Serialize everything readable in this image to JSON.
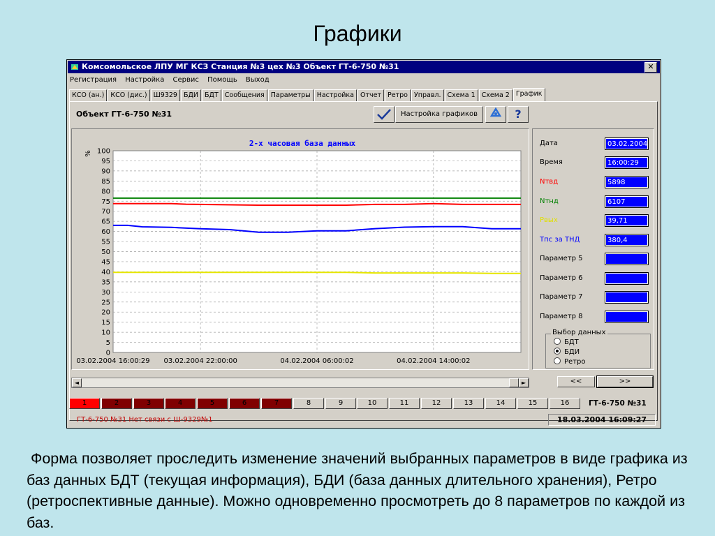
{
  "slide": {
    "title": "Графики",
    "caption": " Форма позволяет проследить изменение значений выбранных параметров в виде графика из баз данных БДТ (текущая информация), БДИ (база данных длительного хранения), Ретро (ретроспективные данные).  Можно одновременно просмотреть до 8 параметров по каждой из баз."
  },
  "window": {
    "title": "Комсомольское ЛПУ МГ КСЗ Станция №3  цех №3  Объект ГТ-6-750 №31",
    "close_label": "✕",
    "icon": "app-icon"
  },
  "menu": [
    "Регистрация",
    "Настройка",
    "Сервис",
    "Помощь",
    "Выход"
  ],
  "tabs": [
    "КСО (ан.)",
    "КСО (дис.)",
    "Ш9329",
    "БДИ",
    "БДТ",
    "Сообщения",
    "Параметры",
    "Настройка",
    "Отчет",
    "Ретро",
    "Управл.",
    "Схема 1",
    "Схема 2",
    "График"
  ],
  "active_tab": "График",
  "toolbar": {
    "object_label": "Объект ГТ-6-750 №31",
    "settings_button": "Настройка графиков",
    "icons": [
      "checkmark-icon",
      "recycle-icon",
      "help-icon"
    ]
  },
  "params": [
    {
      "label": "Дата",
      "value": "03.02.2004",
      "color": "#000000"
    },
    {
      "label": "Время",
      "value": "16:00:29",
      "color": "#000000"
    },
    {
      "label": "Nтвд",
      "value": "5898",
      "color": "#ff0000"
    },
    {
      "label": "Nтнд",
      "value": "6107",
      "color": "#008000"
    },
    {
      "label": "Рвых",
      "value": "39,71",
      "color": "#e0e000"
    },
    {
      "label": "Тпс за ТНД",
      "value": "380,4",
      "color": "#0000ff"
    },
    {
      "label": "Параметр 5",
      "value": "",
      "color": "#000000"
    },
    {
      "label": "Параметр 6",
      "value": "",
      "color": "#000000"
    },
    {
      "label": "Параметр 7",
      "value": "",
      "color": "#000000"
    },
    {
      "label": "Параметр 8",
      "value": "",
      "color": "#000000"
    }
  ],
  "data_select": {
    "title": "Выбор данных",
    "options": [
      "БДТ",
      "БДИ",
      "Ретро"
    ],
    "selected": "БДИ"
  },
  "nav": {
    "prev": "<<",
    "next": ">>"
  },
  "scroll": {
    "left": "◄",
    "right": "►"
  },
  "numbers": {
    "items": [
      "1",
      "2",
      "3",
      "4",
      "5",
      "6",
      "7",
      "8",
      "9",
      "10",
      "11",
      "12",
      "13",
      "14",
      "15",
      "16"
    ],
    "active": "1",
    "red_count": 7,
    "object_name": "ГТ-6-750 №31"
  },
  "status": {
    "message": "ГТ-6-750 №31 Нет связи с Ш-9329№1",
    "datetime": "18.03.2004 16:09:27"
  },
  "chart_data": {
    "type": "line",
    "title": "2-х часовая база данных",
    "ylabel": "%",
    "ylim": [
      0,
      100
    ],
    "yticks": [
      0,
      5,
      10,
      15,
      20,
      25,
      30,
      35,
      40,
      45,
      50,
      55,
      60,
      65,
      70,
      75,
      80,
      85,
      90,
      95,
      100
    ],
    "x_tick_labels": [
      "03.02.2004 16:00:29",
      "03.02.2004 22:00:00",
      "04.02.2004 06:00:02",
      "04.02.2004 14:00:02"
    ],
    "x_tick_hours": [
      0,
      6,
      14,
      22
    ],
    "x_range_hours": [
      0,
      28
    ],
    "grid": true,
    "series": [
      {
        "name": "Nтнд",
        "color": "#008000",
        "x": [
          0,
          28
        ],
        "values": [
          76.5,
          76.5
        ]
      },
      {
        "name": "Nтвд",
        "color": "#ff0000",
        "x": [
          0,
          4,
          5,
          10,
          12,
          16,
          18,
          20,
          22,
          24,
          26,
          28
        ],
        "values": [
          73.8,
          73.8,
          73.5,
          73.0,
          73.0,
          73.0,
          73.4,
          73.4,
          73.8,
          73.4,
          73.4,
          73.4
        ]
      },
      {
        "name": "Тпс за ТНД",
        "color": "#0000ff",
        "x": [
          0,
          1,
          2,
          4,
          6,
          8,
          10,
          12,
          14,
          16,
          18,
          20,
          22,
          24,
          26,
          28
        ],
        "values": [
          63.0,
          63.0,
          62.3,
          62.0,
          61.3,
          60.9,
          59.6,
          59.6,
          60.3,
          60.3,
          61.4,
          62.1,
          62.4,
          62.4,
          61.3,
          61.3
        ]
      },
      {
        "name": "Рвых",
        "color": "#e6e600",
        "x": [
          0,
          16,
          18,
          24,
          26,
          28
        ],
        "values": [
          39.7,
          39.7,
          39.4,
          39.4,
          39.2,
          39.2
        ]
      }
    ]
  }
}
